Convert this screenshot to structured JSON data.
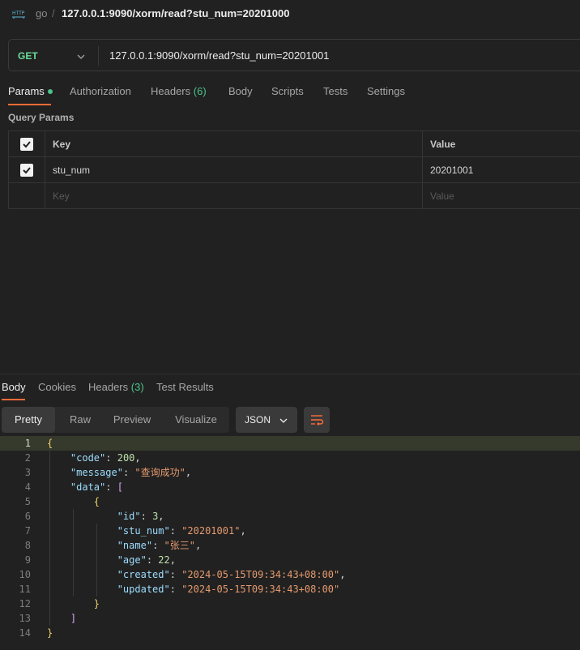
{
  "header": {
    "workspace": "go",
    "separator": "/",
    "request_title": "127.0.0.1:9090/xorm/read?stu_num=20201000"
  },
  "request": {
    "method": "GET",
    "url": "127.0.0.1:9090/xorm/read?stu_num=20201001"
  },
  "request_tabs": {
    "params": "Params",
    "authorization": "Authorization",
    "headers": "Headers",
    "headers_count": "(6)",
    "body": "Body",
    "scripts": "Scripts",
    "tests": "Tests",
    "settings": "Settings"
  },
  "query_params": {
    "title": "Query Params",
    "key_header": "Key",
    "value_header": "Value",
    "rows": [
      {
        "key": "stu_num",
        "value": "20201001",
        "checked": true
      }
    ],
    "key_placeholder": "Key",
    "value_placeholder": "Value"
  },
  "response_tabs": {
    "body": "Body",
    "cookies": "Cookies",
    "headers": "Headers",
    "headers_count": "(3)",
    "test_results": "Test Results"
  },
  "view_modes": {
    "pretty": "Pretty",
    "raw": "Raw",
    "preview": "Preview",
    "visualize": "Visualize"
  },
  "format": "JSON",
  "response_lines": [
    "{",
    "    \"code\": 200,",
    "    \"message\": \"查询成功\",",
    "    \"data\": [",
    "        {",
    "            \"id\": 3,",
    "            \"stu_num\": \"20201001\",",
    "            \"name\": \"张三\",",
    "            \"age\": 22,",
    "            \"created\": \"2024-05-15T09:34:43+08:00\",",
    "            \"updated\": \"2024-05-15T09:34:43+08:00\"",
    "        }",
    "    ]",
    "}"
  ],
  "colors": {
    "accent": "#ff6c37",
    "method_get": "#6bdd9a",
    "badge_green": "#4cc38a"
  }
}
